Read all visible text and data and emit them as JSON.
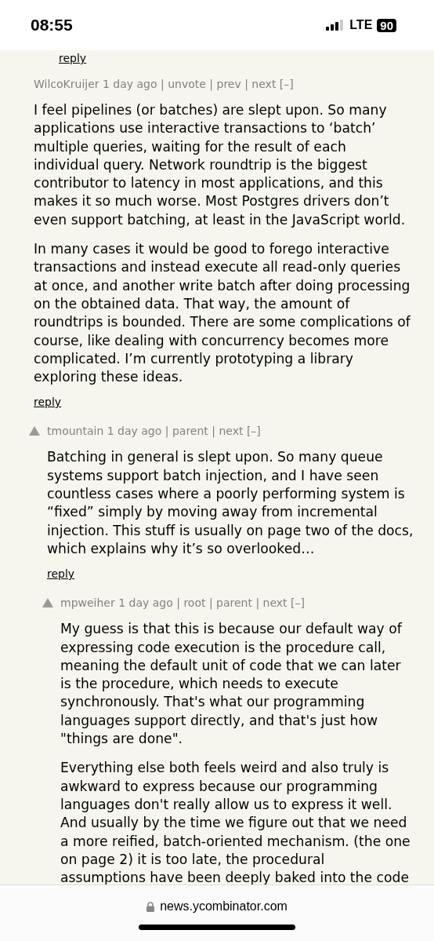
{
  "status_bar": {
    "time": "08:55",
    "network": "LTE",
    "battery": "90"
  },
  "top_reply": "reply",
  "comments": [
    {
      "meta": "WilcoKruijer 1 day ago | unvote | prev | next [–]",
      "voted": true,
      "paragraphs": [
        "I feel pipelines (or batches) are slept upon. So many applications use interactive transactions to ‘batch’ multiple queries, waiting for the result of each individual query. Network roundtrip is the biggest contributor to latency in most applications, and this makes it so much worse. Most Postgres drivers don’t even support batching, at least in the JavaScript world.",
        "In many cases it would be good to forego interactive transactions and instead execute all read-only queries at once, and another write batch after doing processing on the obtained data. That way, the amount of roundtrips is bounded. There are some complications of course, like dealing with concurrency becomes more complicated. I’m currently prototyping a library exploring these ideas."
      ],
      "reply": "reply",
      "children": [
        {
          "meta": "tmountain 1 day ago | parent | next [–]",
          "voted": false,
          "paragraphs": [
            "Batching in general is slept upon. So many queue systems support batch injection, and I have seen countless cases where a poorly performing system is “fixed” simply by moving away from incremental injection. This stuff is usually on page two of the docs, which explains why it’s so overlooked…"
          ],
          "reply": "reply",
          "children": [
            {
              "meta": "mpweiher 1 day ago | root | parent | next [–]",
              "voted": false,
              "paragraphs": [
                "My guess is that this is because our default way of expressing code execution is the procedure call, meaning the default unit of code that we can later is the procedure, which needs to execute synchronously. That's what our programming languages support directly, and that's just how \"things are done\".",
                "Everything else both feels weird and also truly is awkward to express because our programming languages don't really allow us to express it well. And usually by the time we figure out that we need a more reified, batch-oriented mechanism. (the one on page 2) it is too late, the procedural assumptions have been deeply baked into the code"
              ]
            }
          ]
        }
      ]
    }
  ],
  "url": "news.ycombinator.com"
}
